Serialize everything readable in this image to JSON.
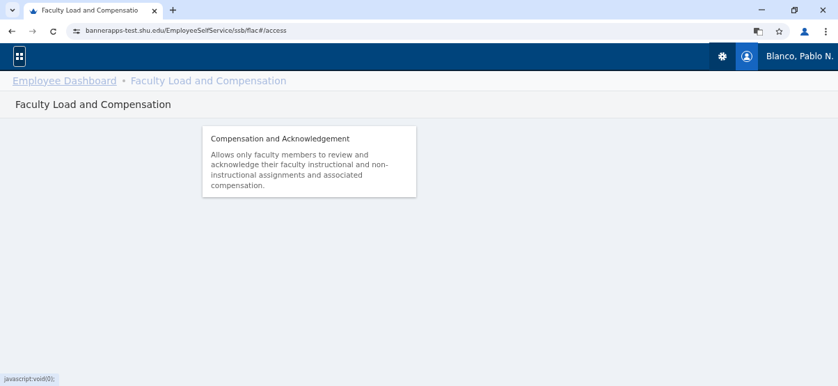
{
  "browser": {
    "tab_title": "Faculty Load and Compensatio",
    "url": "bannerapps-test.shu.edu/EmployeeSelfService/ssb/flac#/access"
  },
  "header": {
    "user_name": "Blanco, Pablo N."
  },
  "breadcrumbs": [
    {
      "label": "Employee Dashboard",
      "kind": "link"
    },
    {
      "label": "Faculty Load and Compensation",
      "kind": "current"
    }
  ],
  "page_title": "Faculty Load and Compensation",
  "cards": [
    {
      "title": "Compensation and Acknowledgement",
      "description": "Allows only faculty members to review and acknowledge their faculty instructional and non-instructional assignments and associated compensation."
    }
  ],
  "status_bar": "javascript:void(0);"
}
